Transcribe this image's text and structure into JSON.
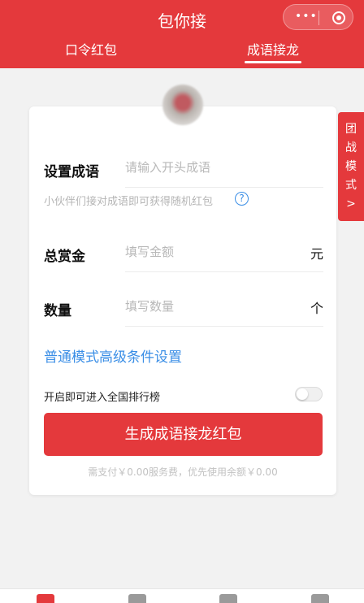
{
  "header": {
    "title": "包你接",
    "capsule_dots": "•••",
    "tabs": [
      {
        "label": "口令红包",
        "active": false
      },
      {
        "label": "成语接龙",
        "active": true
      }
    ],
    "background_color": "#e4393c"
  },
  "side_tab": {
    "label_lines": [
      "团",
      "战",
      "模",
      "式",
      ">"
    ]
  },
  "form": {
    "idiom": {
      "label": "设置成语",
      "placeholder": "请输入开头成语"
    },
    "hint": "小伙伴们接对成语即可获得随机红包",
    "help_icon": "?",
    "amount": {
      "label": "总赏金",
      "placeholder": "填写金额",
      "unit": "元"
    },
    "quantity": {
      "label": "数量",
      "placeholder": "填写数量",
      "unit": "个"
    },
    "advanced_link": "普通模式高级条件设置",
    "leaderboard": {
      "label": "开启即可进入全国排行榜",
      "enabled": false
    },
    "submit_label": "生成成语接龙红包",
    "fee_text": "需支付￥0.00服务费，优先使用余额￥0.00"
  },
  "bottom_nav": {
    "icons": [
      "home-icon",
      "message-icon",
      "explore-icon",
      "profile-icon"
    ],
    "active_index": 0
  },
  "colors": {
    "accent": "#e4393c",
    "link": "#3a8ee6"
  }
}
